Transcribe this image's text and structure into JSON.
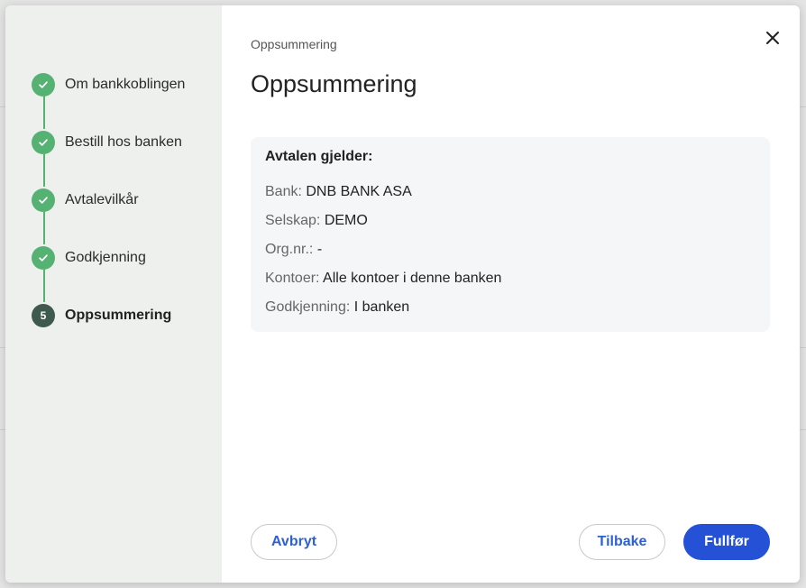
{
  "colors": {
    "step_done": "#55b272",
    "step_current": "#3e5a4d",
    "primary": "#2451d6",
    "link": "#2f5fd4"
  },
  "stepper": {
    "steps": [
      {
        "label": "Om bankkoblingen",
        "state": "done",
        "icon": "check-icon"
      },
      {
        "label": "Bestill hos banken",
        "state": "done",
        "icon": "check-icon"
      },
      {
        "label": "Avtalevilkår",
        "state": "done",
        "icon": "check-icon"
      },
      {
        "label": "Godkjenning",
        "state": "done",
        "icon": "check-icon"
      },
      {
        "label": "Oppsummering",
        "state": "current",
        "number": "5"
      }
    ]
  },
  "header": {
    "breadcrumb": "Oppsummering",
    "title": "Oppsummering",
    "close_icon": "close-icon"
  },
  "summary": {
    "heading": "Avtalen gjelder:",
    "rows": [
      {
        "label": "Bank:",
        "value": "DNB BANK ASA"
      },
      {
        "label": "Selskap:",
        "value": "DEMO"
      },
      {
        "label": "Org.nr.:",
        "value": "-"
      },
      {
        "label": "Kontoer:",
        "value": "Alle kontoer i denne banken"
      },
      {
        "label": "Godkjenning:",
        "value": "I banken"
      }
    ]
  },
  "footer": {
    "cancel_label": "Avbryt",
    "back_label": "Tilbake",
    "finish_label": "Fullfør"
  }
}
